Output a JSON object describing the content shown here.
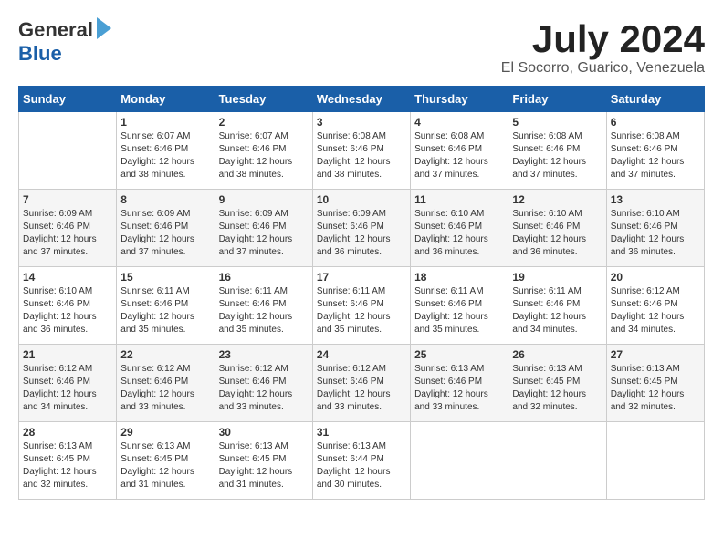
{
  "header": {
    "logo_general": "General",
    "logo_blue": "Blue",
    "month_title": "July 2024",
    "location": "El Socorro, Guarico, Venezuela"
  },
  "days_of_week": [
    "Sunday",
    "Monday",
    "Tuesday",
    "Wednesday",
    "Thursday",
    "Friday",
    "Saturday"
  ],
  "weeks": [
    [
      {
        "day": "",
        "content": ""
      },
      {
        "day": "1",
        "content": "Sunrise: 6:07 AM\nSunset: 6:46 PM\nDaylight: 12 hours\nand 38 minutes."
      },
      {
        "day": "2",
        "content": "Sunrise: 6:07 AM\nSunset: 6:46 PM\nDaylight: 12 hours\nand 38 minutes."
      },
      {
        "day": "3",
        "content": "Sunrise: 6:08 AM\nSunset: 6:46 PM\nDaylight: 12 hours\nand 38 minutes."
      },
      {
        "day": "4",
        "content": "Sunrise: 6:08 AM\nSunset: 6:46 PM\nDaylight: 12 hours\nand 37 minutes."
      },
      {
        "day": "5",
        "content": "Sunrise: 6:08 AM\nSunset: 6:46 PM\nDaylight: 12 hours\nand 37 minutes."
      },
      {
        "day": "6",
        "content": "Sunrise: 6:08 AM\nSunset: 6:46 PM\nDaylight: 12 hours\nand 37 minutes."
      }
    ],
    [
      {
        "day": "7",
        "content": "Sunrise: 6:09 AM\nSunset: 6:46 PM\nDaylight: 12 hours\nand 37 minutes."
      },
      {
        "day": "8",
        "content": "Sunrise: 6:09 AM\nSunset: 6:46 PM\nDaylight: 12 hours\nand 37 minutes."
      },
      {
        "day": "9",
        "content": "Sunrise: 6:09 AM\nSunset: 6:46 PM\nDaylight: 12 hours\nand 37 minutes."
      },
      {
        "day": "10",
        "content": "Sunrise: 6:09 AM\nSunset: 6:46 PM\nDaylight: 12 hours\nand 36 minutes."
      },
      {
        "day": "11",
        "content": "Sunrise: 6:10 AM\nSunset: 6:46 PM\nDaylight: 12 hours\nand 36 minutes."
      },
      {
        "day": "12",
        "content": "Sunrise: 6:10 AM\nSunset: 6:46 PM\nDaylight: 12 hours\nand 36 minutes."
      },
      {
        "day": "13",
        "content": "Sunrise: 6:10 AM\nSunset: 6:46 PM\nDaylight: 12 hours\nand 36 minutes."
      }
    ],
    [
      {
        "day": "14",
        "content": "Sunrise: 6:10 AM\nSunset: 6:46 PM\nDaylight: 12 hours\nand 36 minutes."
      },
      {
        "day": "15",
        "content": "Sunrise: 6:11 AM\nSunset: 6:46 PM\nDaylight: 12 hours\nand 35 minutes."
      },
      {
        "day": "16",
        "content": "Sunrise: 6:11 AM\nSunset: 6:46 PM\nDaylight: 12 hours\nand 35 minutes."
      },
      {
        "day": "17",
        "content": "Sunrise: 6:11 AM\nSunset: 6:46 PM\nDaylight: 12 hours\nand 35 minutes."
      },
      {
        "day": "18",
        "content": "Sunrise: 6:11 AM\nSunset: 6:46 PM\nDaylight: 12 hours\nand 35 minutes."
      },
      {
        "day": "19",
        "content": "Sunrise: 6:11 AM\nSunset: 6:46 PM\nDaylight: 12 hours\nand 34 minutes."
      },
      {
        "day": "20",
        "content": "Sunrise: 6:12 AM\nSunset: 6:46 PM\nDaylight: 12 hours\nand 34 minutes."
      }
    ],
    [
      {
        "day": "21",
        "content": "Sunrise: 6:12 AM\nSunset: 6:46 PM\nDaylight: 12 hours\nand 34 minutes."
      },
      {
        "day": "22",
        "content": "Sunrise: 6:12 AM\nSunset: 6:46 PM\nDaylight: 12 hours\nand 33 minutes."
      },
      {
        "day": "23",
        "content": "Sunrise: 6:12 AM\nSunset: 6:46 PM\nDaylight: 12 hours\nand 33 minutes."
      },
      {
        "day": "24",
        "content": "Sunrise: 6:12 AM\nSunset: 6:46 PM\nDaylight: 12 hours\nand 33 minutes."
      },
      {
        "day": "25",
        "content": "Sunrise: 6:13 AM\nSunset: 6:46 PM\nDaylight: 12 hours\nand 33 minutes."
      },
      {
        "day": "26",
        "content": "Sunrise: 6:13 AM\nSunset: 6:45 PM\nDaylight: 12 hours\nand 32 minutes."
      },
      {
        "day": "27",
        "content": "Sunrise: 6:13 AM\nSunset: 6:45 PM\nDaylight: 12 hours\nand 32 minutes."
      }
    ],
    [
      {
        "day": "28",
        "content": "Sunrise: 6:13 AM\nSunset: 6:45 PM\nDaylight: 12 hours\nand 32 minutes."
      },
      {
        "day": "29",
        "content": "Sunrise: 6:13 AM\nSunset: 6:45 PM\nDaylight: 12 hours\nand 31 minutes."
      },
      {
        "day": "30",
        "content": "Sunrise: 6:13 AM\nSunset: 6:45 PM\nDaylight: 12 hours\nand 31 minutes."
      },
      {
        "day": "31",
        "content": "Sunrise: 6:13 AM\nSunset: 6:44 PM\nDaylight: 12 hours\nand 30 minutes."
      },
      {
        "day": "",
        "content": ""
      },
      {
        "day": "",
        "content": ""
      },
      {
        "day": "",
        "content": ""
      }
    ]
  ]
}
